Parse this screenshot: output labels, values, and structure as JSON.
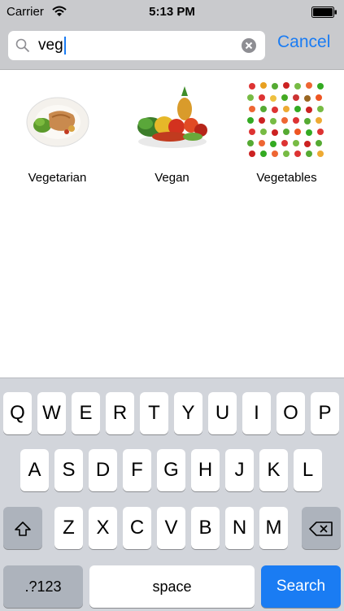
{
  "status_bar": {
    "carrier": "Carrier",
    "time": "5:13 PM"
  },
  "search": {
    "query": "veg",
    "cancel_label": "Cancel"
  },
  "results": [
    {
      "label": "Vegetarian"
    },
    {
      "label": "Vegan"
    },
    {
      "label": "Vegetables"
    }
  ],
  "keyboard": {
    "row1": [
      "Q",
      "W",
      "E",
      "R",
      "T",
      "Y",
      "U",
      "I",
      "O",
      "P"
    ],
    "row2": [
      "A",
      "S",
      "D",
      "F",
      "G",
      "H",
      "J",
      "K",
      "L"
    ],
    "row3": [
      "Z",
      "X",
      "C",
      "V",
      "B",
      "N",
      "M"
    ],
    "numbers_label": ".?123",
    "space_label": "space",
    "search_label": "Search"
  },
  "colors": {
    "accent": "#1a7cf3",
    "keyboard_bg": "#d2d5db",
    "bar_bg": "#c9cacd"
  },
  "icons": [
    "wifi-icon",
    "battery-icon",
    "search-icon",
    "clear-icon",
    "shift-icon",
    "backspace-icon"
  ]
}
